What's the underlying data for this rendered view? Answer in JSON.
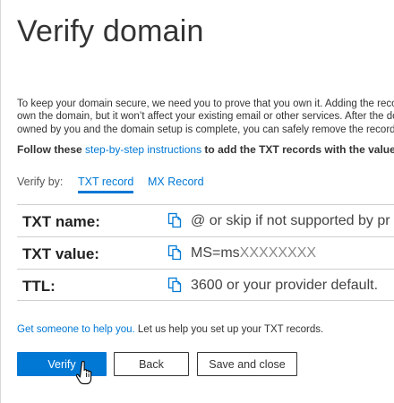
{
  "page": {
    "title": "Verify domain",
    "intro_lines": [
      "To keep your domain secure, we need you to prove that you own it. Adding the records",
      "own the domain, but it won’t affect your existing email or other services. After the dom",
      "owned by you and the domain setup is complete, you can safely remove the records"
    ],
    "follow": {
      "prefix": "Follow these ",
      "link": "step-by-step instructions",
      "suffix": " to add the TXT records with the value"
    }
  },
  "verify_by": {
    "label": "Verify by:",
    "tabs": [
      {
        "label": "TXT record",
        "selected": true
      },
      {
        "label": "MX Record",
        "selected": false
      }
    ]
  },
  "records": [
    {
      "label": "TXT name:",
      "value": "@ or skip if not supported by pr",
      "value_masked": ""
    },
    {
      "label": "TXT value:",
      "value": "MS=ms",
      "value_masked": "XXXXXXXX"
    },
    {
      "label": "TTL:",
      "value": "3600 or your provider default.",
      "value_masked": ""
    }
  ],
  "help": {
    "link": "Get someone to help you.",
    "text": " Let us help you set up your TXT records."
  },
  "buttons": {
    "verify": "Verify",
    "back": "Back",
    "save_close": "Save and close"
  },
  "icons": {
    "copy": "copy-icon",
    "cursor": "hand-pointer-icon"
  },
  "colors": {
    "accent": "#0078d4",
    "text": "#333333",
    "masked": "#8a8a8a"
  }
}
